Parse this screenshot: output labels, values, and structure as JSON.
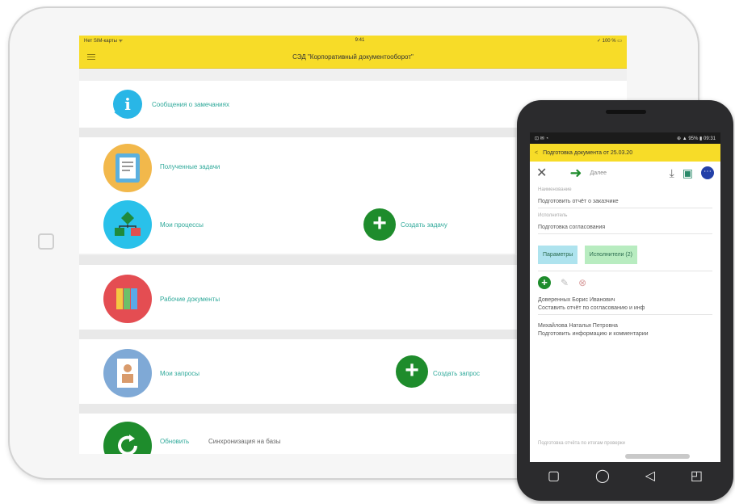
{
  "tablet": {
    "status": {
      "left": "Нет SIM-карты ᯤ",
      "time": "9:41",
      "right": "✓ 100 % ▭"
    },
    "header_title": "СЭД \"Корпоративный документооборот\"",
    "rows": [
      {
        "label": "Сообщения о замечаниях"
      },
      {
        "label": "Полученные задачи"
      },
      {
        "label": "Мои процессы",
        "action": "Создать задачу"
      },
      {
        "label": "Рабочие документы"
      },
      {
        "label": "Мои запросы",
        "action": "Создать запрос"
      },
      {
        "label": "Обновить",
        "extra": "Синхронизация на базы"
      }
    ],
    "plus_symbol": "+",
    "colors": {
      "accent": "#f7dc28",
      "label": "#2fa99a",
      "action": "#1e8c2c"
    }
  },
  "phone": {
    "status": {
      "left": "⊡ ✉ ◔",
      "right": "⊕ ▲ 95% ▮ 09:31"
    },
    "title": "Подготовка документа от 25.03.20",
    "back": "<",
    "toolbar": {
      "close": "✕",
      "arrow": "➜",
      "forward_label": "Далее",
      "download": "⤓",
      "save": "▣",
      "more": "⋯"
    },
    "field1": {
      "label": "Наименование",
      "value": "Подготовить отчёт о заказчике"
    },
    "field2": {
      "label": "Исполнитель",
      "value": "Подготовка согласования"
    },
    "tabs": [
      "Параметры",
      "Исполнители (2)"
    ],
    "icons": {
      "add": "+",
      "edit": "✎",
      "delete": "⊗"
    },
    "list": [
      {
        "name": "Доверенных Борис Иванович",
        "desc": "Составить отчёт по согласованию и инф"
      },
      {
        "name": "Михайлова Наталья Петровна",
        "desc": "Подготовить информацию и комментарии"
      }
    ],
    "bottom_hint": "Подготовка отчёта по итогам проверки",
    "nav": {
      "recent": "▢",
      "home": "◯",
      "back": "◁",
      "menu": "◰"
    }
  }
}
